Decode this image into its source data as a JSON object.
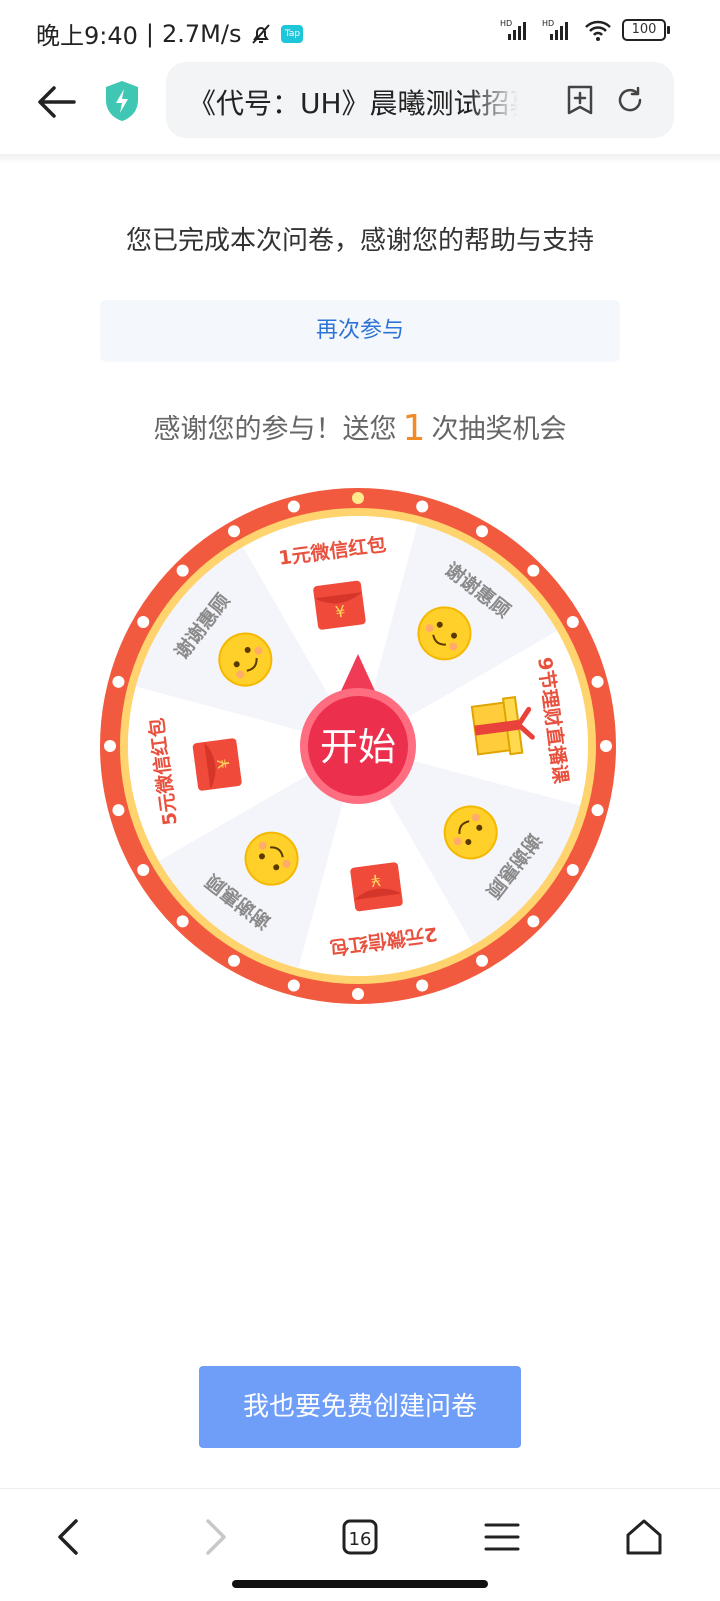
{
  "status_bar": {
    "time": "晚上9:40",
    "network_speed": "2.7M/s",
    "app_badge": "Tap",
    "battery": "100",
    "signal_labels": [
      "HD",
      "HD"
    ]
  },
  "browser": {
    "url_title": "《代号：UH》晨曦测试招募"
  },
  "page": {
    "done_message": "您已完成本次问卷，感谢您的帮助与支持",
    "retry_label": "再次参与",
    "lottery_prefix": "感谢您的参与！送您",
    "lottery_count": "1",
    "lottery_suffix": "次抽奖机会",
    "create_label": "我也要免费创建问卷"
  },
  "wheel": {
    "start_label": "开始",
    "prizes": [
      {
        "label": "谢谢惠顾",
        "icon": "smiley-icon"
      },
      {
        "label": "9节理财直播课",
        "icon": "gift-icon"
      },
      {
        "label": "谢谢惠顾",
        "icon": "smiley-icon"
      },
      {
        "label": "2元微信红包",
        "icon": "red-envelope-icon"
      },
      {
        "label": "谢谢惠顾",
        "icon": "smiley-icon"
      },
      {
        "label": "5元微信红包",
        "icon": "red-envelope-icon"
      },
      {
        "label": "谢谢惠顾",
        "icon": "smiley-icon"
      },
      {
        "label": "1元微信红包",
        "icon": "red-envelope-icon"
      }
    ]
  },
  "bottom_nav": {
    "tab_count": "16"
  },
  "colors": {
    "wheel_rim": "#f25a3f",
    "wheel_inner_ring": "#ffd36e",
    "segment_light": "#f4f5fb",
    "segment_white": "#ffffff",
    "prize_text": "#e8513e",
    "thanks_text": "#8a8a8a",
    "center_button": "#f03b56",
    "create_button": "#6f9ef8",
    "retry_text": "#2d73d8",
    "lottery_accent": "#f08b28"
  }
}
